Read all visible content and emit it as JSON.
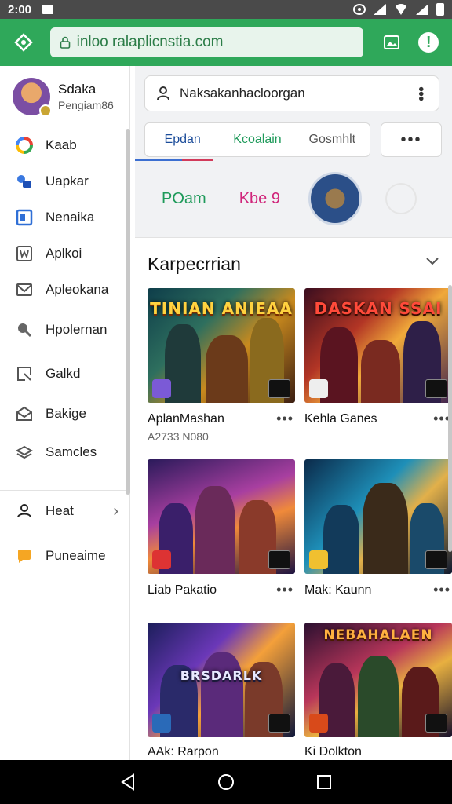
{
  "status_bar": {
    "time": "2:00"
  },
  "browser": {
    "url": "inloo ralaplicnstia.com"
  },
  "sidebar": {
    "profile": {
      "name": "Sdaka",
      "subtitle": "Pengiam86"
    },
    "items": [
      {
        "label": "Kaab",
        "icon": "colorful-swirl-icon"
      },
      {
        "label": "Uapkar",
        "icon": "blue-chat-icon"
      },
      {
        "label": "Nenaika",
        "icon": "blue-square-icon"
      },
      {
        "label": "Aplkoi",
        "icon": "framed-w-icon"
      },
      {
        "label": "Apleokana",
        "icon": "mail-icon"
      },
      {
        "label": "Hpolernan",
        "icon": "search-icon"
      },
      {
        "label": "Galkd",
        "icon": "corner-arrow-icon"
      },
      {
        "label": "Bakige",
        "icon": "envelope-open-icon"
      },
      {
        "label": "Samcles",
        "icon": "layers-icon"
      }
    ],
    "account_item": {
      "label": "Heat",
      "icon": "person-icon"
    },
    "footer_item": {
      "label": "Puneaime",
      "icon": "orange-chat-icon"
    }
  },
  "search": {
    "query": "Naksakanhacloorgan"
  },
  "tabs": [
    {
      "label": "Epdan"
    },
    {
      "label": "Kcoalain"
    },
    {
      "label": "Gosmhlt"
    }
  ],
  "tab_more": {
    "label": "•••"
  },
  "chips": {
    "first": "POam",
    "second": "Kbe 9"
  },
  "section": {
    "title": "Karpecrrian",
    "items": [
      {
        "name": "AplanMashan",
        "subtitle": "A2733 N080",
        "art_text": "TINIAN ANIEAA"
      },
      {
        "name": "Kehla Ganes",
        "subtitle": "",
        "art_text": "DASKAN SSAI"
      },
      {
        "name": "Liab Pakatio",
        "subtitle": "",
        "art_text": ""
      },
      {
        "name": "Mak: Kaunn",
        "subtitle": "",
        "art_text": ""
      },
      {
        "name": "AAk: Rarpon",
        "subtitle": "",
        "art_text": "BRSDARLK"
      },
      {
        "name": "Ki Dolkton",
        "subtitle": "",
        "art_text": "NEBAHALAEN"
      }
    ]
  },
  "colors": {
    "browser_green": "#2fa85a",
    "accent_blue": "#1b4c9a",
    "accent_pink": "#d0257a"
  }
}
